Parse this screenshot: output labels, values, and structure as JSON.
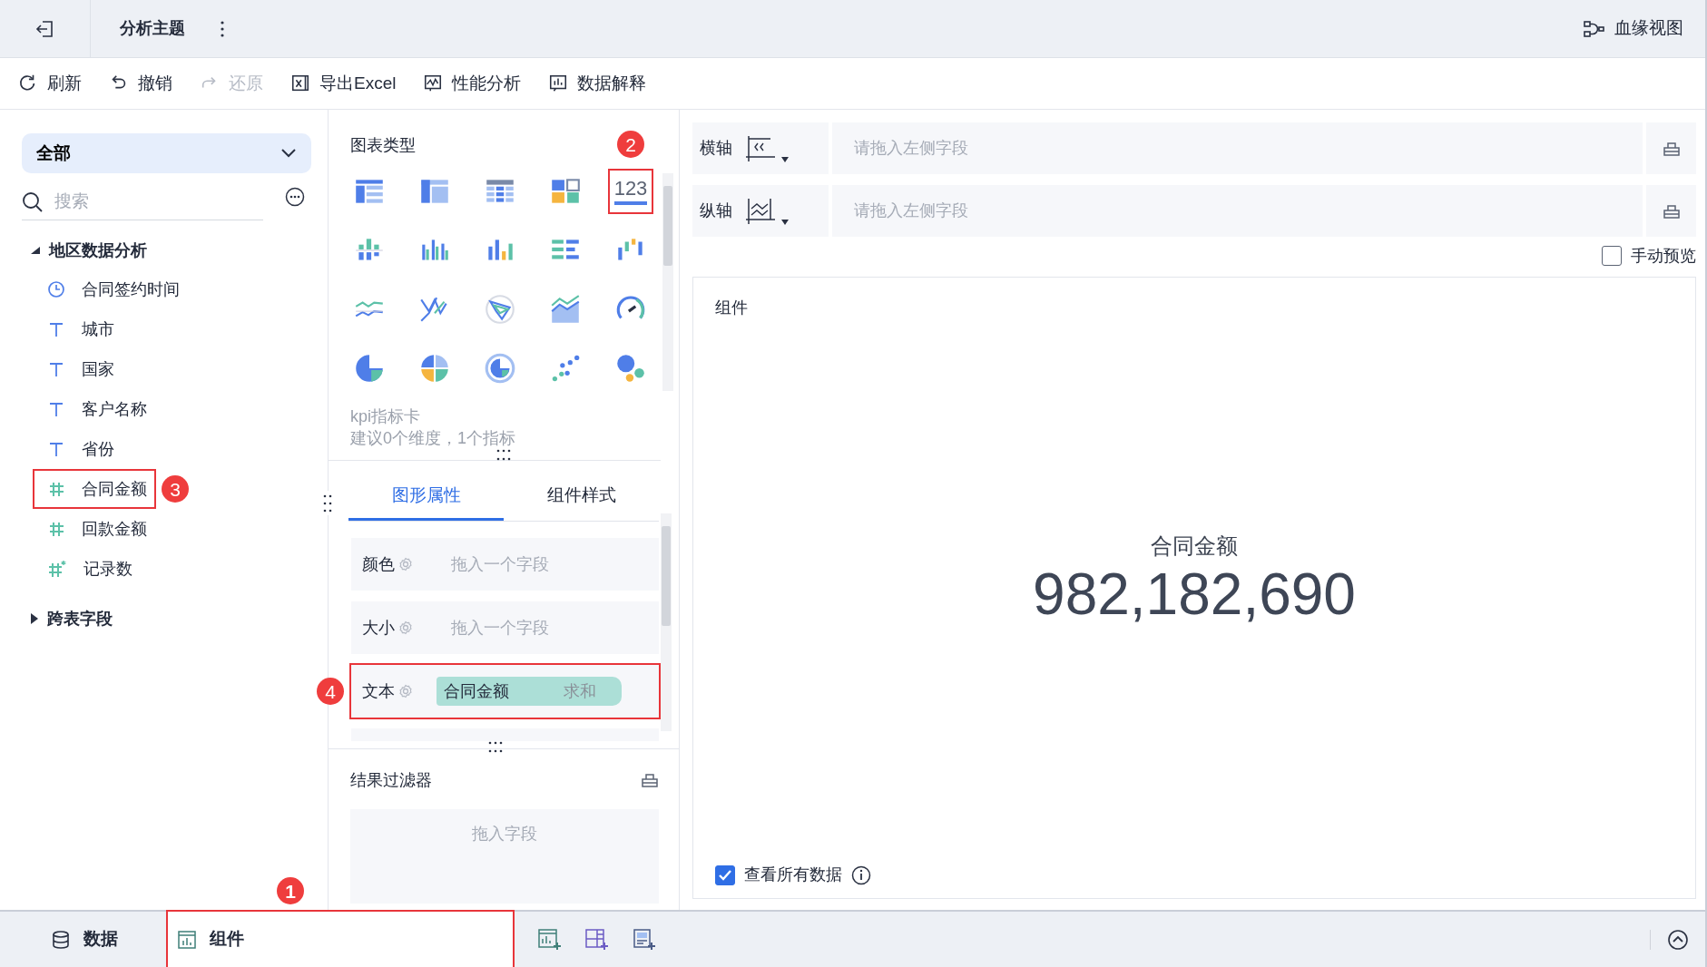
{
  "header": {
    "title": "分析主题",
    "lineage_link": "血缘视图"
  },
  "toolbar": [
    {
      "label": "刷新",
      "kind": "refresh",
      "disabled": false
    },
    {
      "label": "撤销",
      "kind": "undo",
      "disabled": false
    },
    {
      "label": "还原",
      "kind": "redo",
      "disabled": true
    },
    {
      "label": "导出Excel",
      "kind": "export",
      "disabled": false
    },
    {
      "label": "性能分析",
      "kind": "performance",
      "disabled": false
    },
    {
      "label": "数据解释",
      "kind": "explain",
      "disabled": false
    }
  ],
  "sidebar": {
    "scope": "全部",
    "search": {
      "placeholder": "搜索"
    },
    "groups": [
      {
        "label": "地区数据分析",
        "expanded": true,
        "children": [
          {
            "label": "合同签约时间",
            "kind": "date"
          },
          {
            "label": "城市",
            "kind": "text"
          },
          {
            "label": "国家",
            "kind": "text"
          },
          {
            "label": "客户名称",
            "kind": "text"
          },
          {
            "label": "省份",
            "kind": "text"
          },
          {
            "label": "合同金额",
            "kind": "number",
            "callout": "3"
          },
          {
            "label": "回款金额",
            "kind": "number"
          },
          {
            "label": "记录数",
            "kind": "count"
          }
        ]
      },
      {
        "label": "跨表字段",
        "expanded": false
      }
    ]
  },
  "chart_panel": {
    "title": "图表类型",
    "chart_types": [
      {
        "kind": "table",
        "selected": false
      },
      {
        "kind": "cross-table",
        "selected": false
      },
      {
        "kind": "detail-table",
        "selected": false
      },
      {
        "kind": "blocks",
        "selected": false
      },
      {
        "kind": "kpi",
        "label": "123",
        "selected": true,
        "callout": "2"
      },
      {
        "kind": "stacked-bar",
        "selected": false
      },
      {
        "kind": "grouped-bar",
        "selected": false
      },
      {
        "kind": "bar",
        "selected": false
      },
      {
        "kind": "horizontal-bar",
        "selected": false
      },
      {
        "kind": "waterfall",
        "selected": false
      },
      {
        "kind": "line",
        "selected": false
      },
      {
        "kind": "multi-line",
        "selected": false
      },
      {
        "kind": "radar",
        "selected": false
      },
      {
        "kind": "area",
        "selected": false
      },
      {
        "kind": "gauge",
        "selected": false
      },
      {
        "kind": "pie",
        "selected": false
      },
      {
        "kind": "multi-pie",
        "selected": false
      },
      {
        "kind": "ring",
        "selected": false
      },
      {
        "kind": "scatter",
        "selected": false
      },
      {
        "kind": "bubble",
        "selected": false
      }
    ],
    "description": [
      "kpi指标卡",
      "建议0个维度，1个指标"
    ]
  },
  "property_tabs": [
    {
      "label": "图形属性",
      "selected": true
    },
    {
      "label": "组件样式",
      "selected": false
    }
  ],
  "properties": [
    {
      "label": "颜色",
      "placeholder": "拖入一个字段"
    },
    {
      "label": "大小",
      "placeholder": "拖入一个字段"
    },
    {
      "label": "文本",
      "field": {
        "name": "合同金额",
        "aggregation": "求和"
      },
      "callout": "4"
    }
  ],
  "result_filter": {
    "title": "结果过滤器",
    "placeholder": "拖入字段"
  },
  "axes": [
    {
      "label": "横轴",
      "kind": "x",
      "placeholder": "请拖入左侧字段"
    },
    {
      "label": "纵轴",
      "kind": "y",
      "placeholder": "请拖入左侧字段"
    }
  ],
  "manual_preview": {
    "label": "手动预览",
    "checked": false
  },
  "component": {
    "title": "组件",
    "kpi_label": "合同金额",
    "kpi_value": "982,182,690",
    "view_all": {
      "label": "查看所有数据",
      "checked": true
    }
  },
  "bottom_tabs": [
    {
      "label": "数据",
      "kind": "data",
      "selected": false
    },
    {
      "label": "组件",
      "kind": "component",
      "selected": true,
      "callout": "1"
    }
  ]
}
